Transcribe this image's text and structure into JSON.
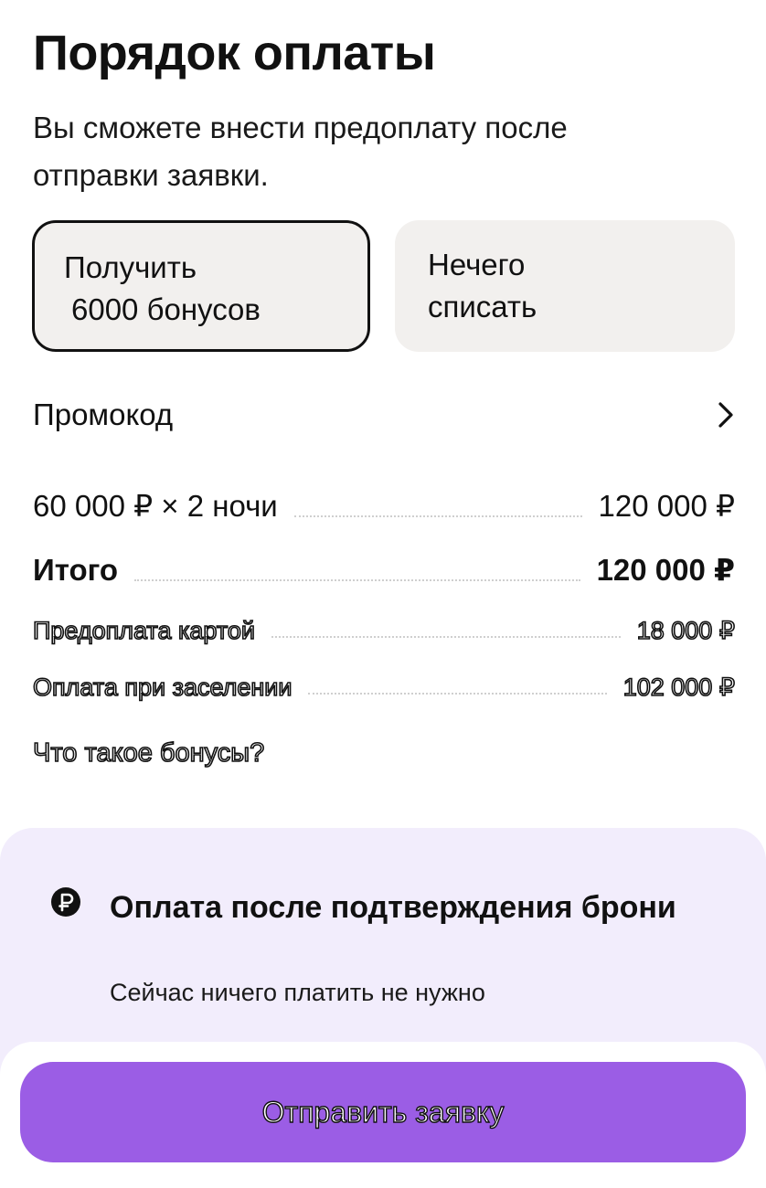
{
  "header": {
    "title": "Порядок оплаты",
    "subtitle": "Вы сможете внести предоплату после отправки заявки."
  },
  "bonus_options": [
    {
      "line1": "Получить",
      "line2": "6000 бонусов",
      "selected": true
    },
    {
      "line1": "Нечего",
      "line2": "списать",
      "selected": false
    }
  ],
  "promo": {
    "label": "Промокод",
    "icon": "chevron-right-icon"
  },
  "pricing": {
    "nights": {
      "label": "60 000 ₽ × 2 ночи",
      "value": "120 000 ₽"
    },
    "total": {
      "label": "Итого",
      "value": "120 000 ₽"
    },
    "prepay": {
      "label": "Предоплата картой",
      "value": "18 000 ₽"
    },
    "checkin": {
      "label": "Оплата при заселении",
      "value": "102 000 ₽"
    }
  },
  "bonus_link": "Что такое бонусы?",
  "info": {
    "icon": "ruble-circle-icon",
    "title": "Оплата после подтверждения брони",
    "subtitle": "Сейчас ничего платить не нужно"
  },
  "submit": {
    "label": "Отправить заявку"
  },
  "colors": {
    "accent": "#9b5de5",
    "info_bg": "#f2edfc",
    "card_bg": "#f2f0ee"
  }
}
